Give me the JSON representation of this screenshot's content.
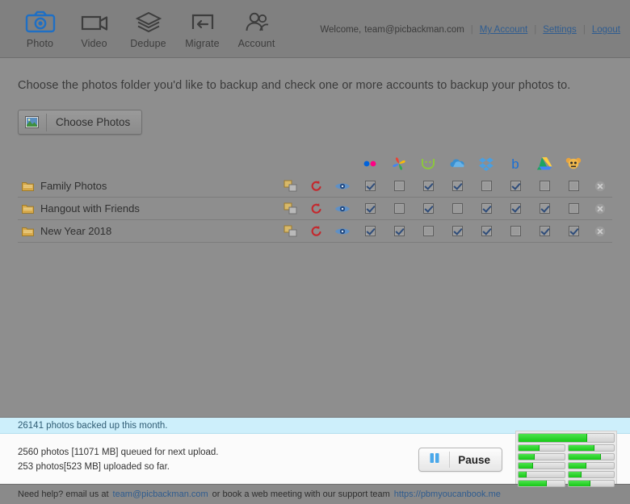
{
  "header": {
    "nav": [
      {
        "label": "Photo",
        "icon": "camera-icon",
        "active": true
      },
      {
        "label": "Video",
        "icon": "video-camera-icon",
        "active": false
      },
      {
        "label": "Dedupe",
        "icon": "layers-icon",
        "active": false
      },
      {
        "label": "Migrate",
        "icon": "migrate-arrow-icon",
        "active": false
      },
      {
        "label": "Account",
        "icon": "users-icon",
        "active": false
      }
    ],
    "welcome_text": "Welcome,",
    "email": "team@picbackman.com",
    "links": [
      "My Account",
      "Settings",
      "Logout"
    ],
    "separator": "|"
  },
  "main": {
    "instruction": "Choose the photos folder you'd like to backup and check one or more accounts to backup your photos to.",
    "choose_button": {
      "label": "Choose Photos",
      "icon": "picture-thumbnail-icon"
    }
  },
  "services": [
    {
      "name": "flickr",
      "icon": "flickr-icon"
    },
    {
      "name": "google-photos",
      "icon": "google-photos-icon"
    },
    {
      "name": "smugmug",
      "icon": "smugmug-icon"
    },
    {
      "name": "onedrive",
      "icon": "onedrive-icon"
    },
    {
      "name": "dropbox",
      "icon": "dropbox-icon"
    },
    {
      "name": "box",
      "icon": "box-icon"
    },
    {
      "name": "google-drive",
      "icon": "google-drive-icon"
    },
    {
      "name": "photobucket",
      "icon": "photobucket-icon"
    }
  ],
  "row_actions": [
    {
      "name": "duplicate-icon"
    },
    {
      "name": "reset-icon"
    },
    {
      "name": "preview-eye-icon"
    }
  ],
  "folders": [
    {
      "name": "Family Photos",
      "checks": [
        true,
        false,
        true,
        true,
        false,
        true,
        false,
        false
      ]
    },
    {
      "name": "Hangout with Friends",
      "checks": [
        true,
        false,
        true,
        false,
        true,
        true,
        true,
        false
      ]
    },
    {
      "name": "New Year 2018",
      "checks": [
        true,
        true,
        false,
        true,
        true,
        false,
        true,
        true
      ]
    }
  ],
  "status": {
    "banner": "26141 photos backed up this month.",
    "queued": "2560 photos [11071 MB] queued for next upload.",
    "uploaded": "253 photos[523 MB] uploaded so far.",
    "pause_label": "Pause",
    "pause_icon": "pause-icon"
  },
  "progress": {
    "main": 72,
    "rows": [
      [
        46,
        58
      ],
      [
        36,
        72
      ],
      [
        31,
        40
      ],
      [
        17,
        30
      ],
      [
        62,
        48
      ]
    ]
  },
  "footer": {
    "text_before": "Need help? email us at",
    "email": "team@picbackman.com",
    "text_middle": "or book a web meeting with our support team",
    "link": "https://pbmyoucanbook.me"
  },
  "colors": {
    "accent_blue": "#2f5c8f",
    "banner_bg": "#cdeffb",
    "progress_green": "#17c917",
    "folder_amber": "#c79a3a",
    "app_gray": "#8e8e8e"
  }
}
